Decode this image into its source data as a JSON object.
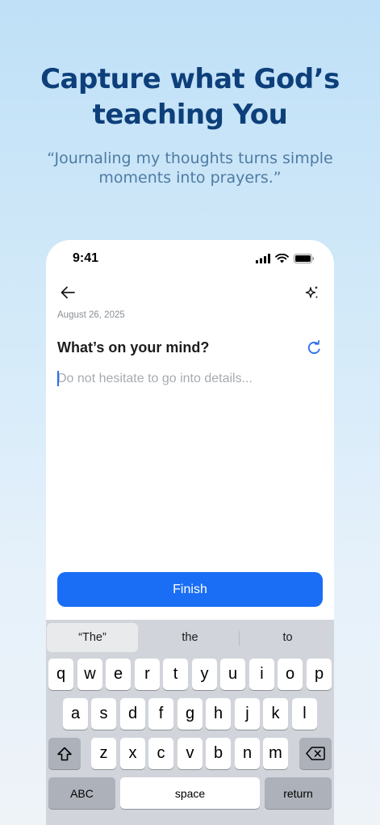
{
  "hero": {
    "headline_line1": "Capture what God’s",
    "headline_line2": "teaching You",
    "quote_line1": "“Journaling my thoughts turns simple",
    "quote_line2": "moments into prayers.”"
  },
  "status_bar": {
    "time": "9:41",
    "icons": [
      "cellular-signal-icon",
      "wifi-icon",
      "battery-icon"
    ]
  },
  "nav": {
    "back_icon": "arrow-left-icon",
    "ai_icon": "sparkle-icon"
  },
  "journal": {
    "date": "August 26, 2025",
    "prompt": "What’s on your mind?",
    "refresh_icon": "refresh-icon",
    "entry_value": "",
    "entry_placeholder": "Do not hesitate to go into details..."
  },
  "actions": {
    "finish_label": "Finish"
  },
  "keyboard": {
    "suggestions": [
      "“The”",
      "the",
      "to"
    ],
    "row1": [
      "q",
      "w",
      "e",
      "r",
      "t",
      "y",
      "u",
      "i",
      "o",
      "p"
    ],
    "row2": [
      "a",
      "s",
      "d",
      "f",
      "g",
      "h",
      "j",
      "k",
      "l"
    ],
    "row3": [
      "z",
      "x",
      "c",
      "v",
      "b",
      "n",
      "m"
    ],
    "shift_icon": "shift-icon",
    "delete_icon": "backspace-icon",
    "abc_label": "ABC",
    "space_label": "space",
    "return_label": "return"
  },
  "colors": {
    "accent": "#1a6ef5",
    "headline": "#0d3f7a",
    "quote": "#4f7ba3"
  }
}
